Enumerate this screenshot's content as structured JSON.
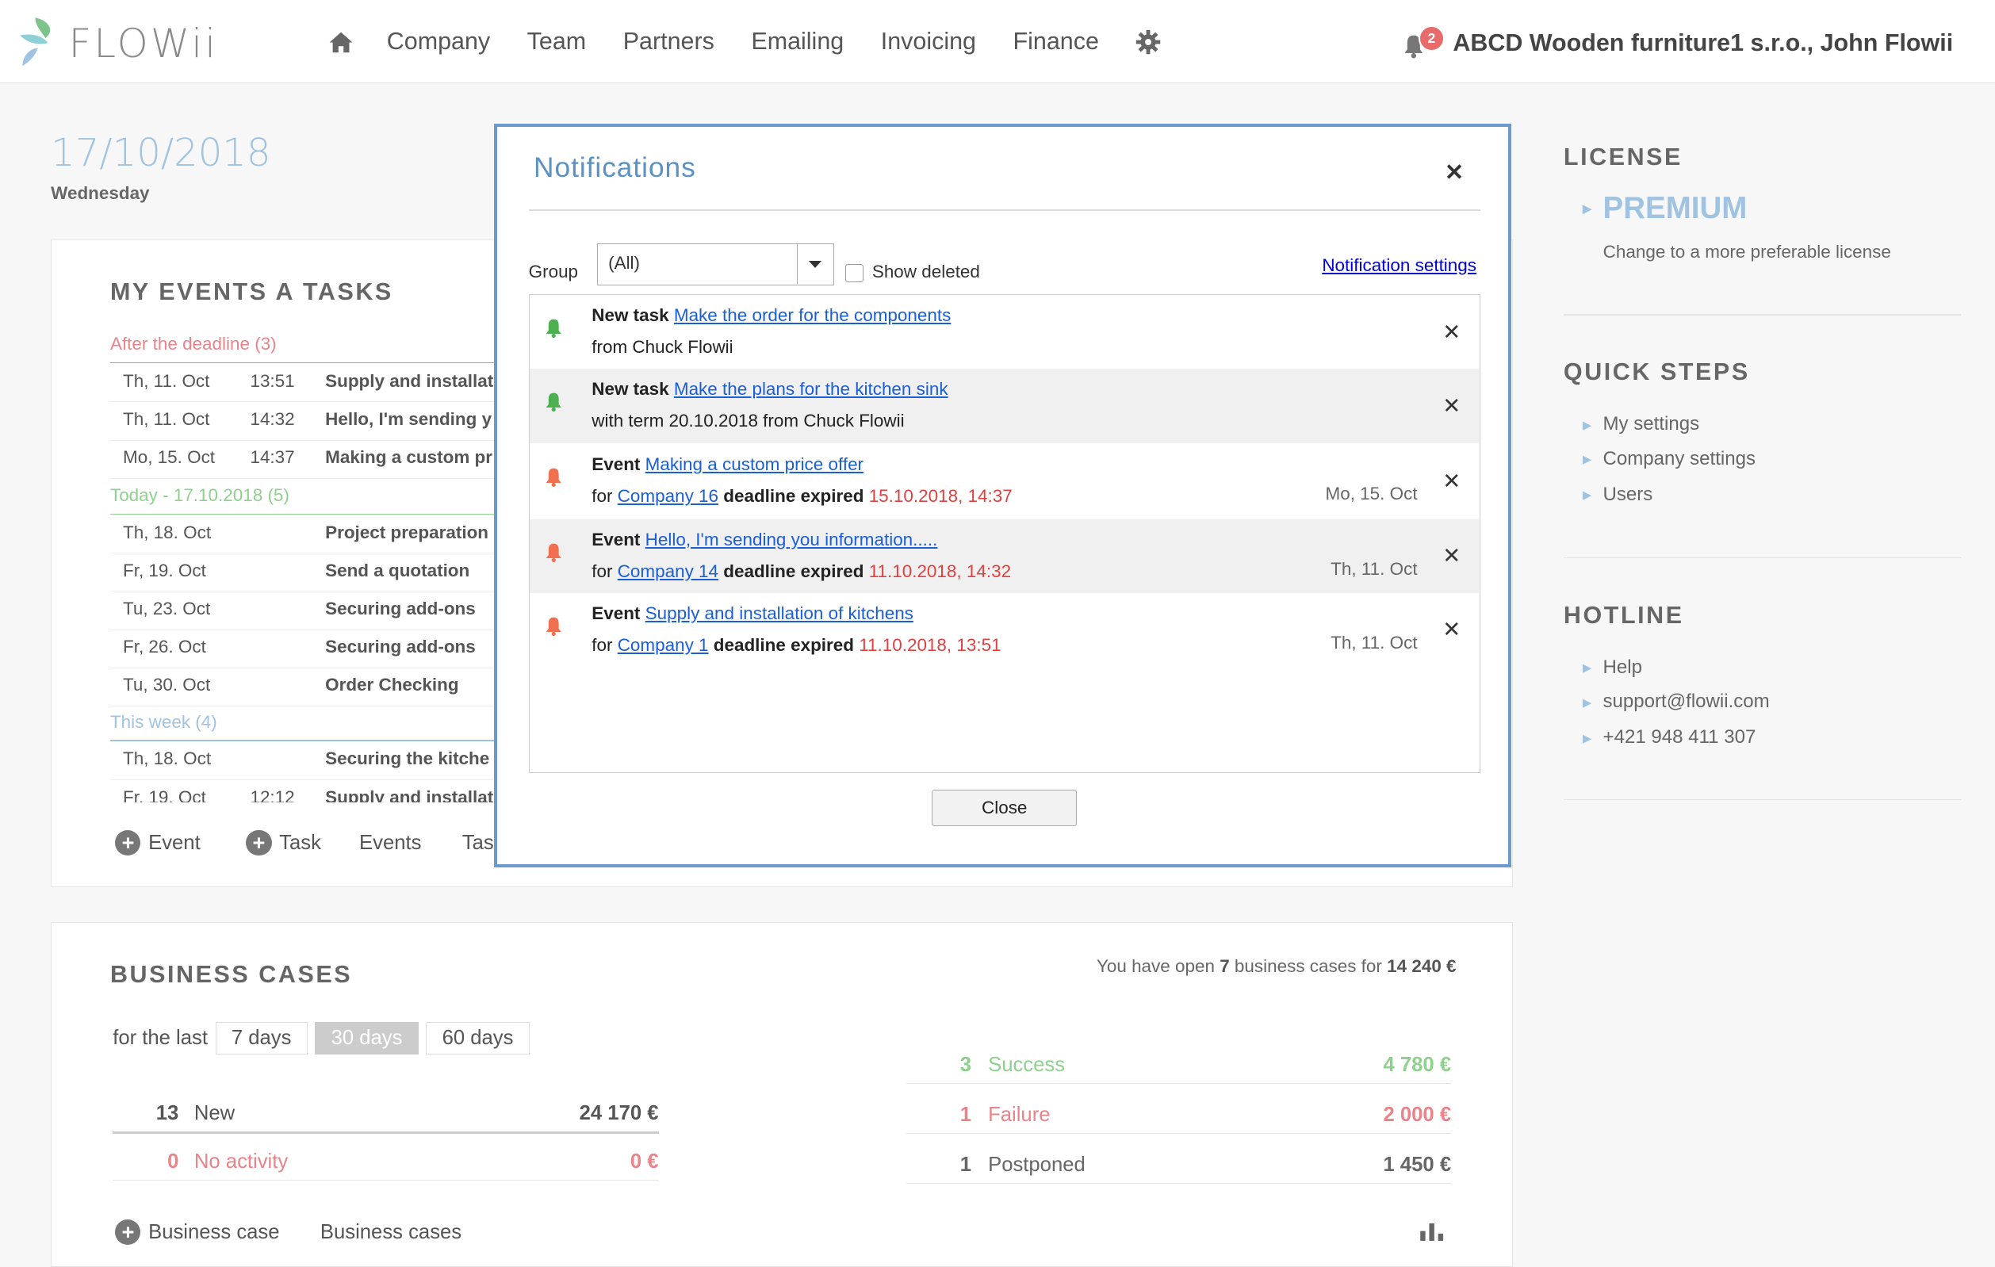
{
  "brand": {
    "logo_text": "FLOWii"
  },
  "nav": {
    "items": [
      "Company",
      "Team",
      "Partners",
      "Emailing",
      "Invoicing",
      "Finance"
    ],
    "notification_count": "2",
    "company_user": "ABCD Wooden furniture1 s.r.o., John Flowii"
  },
  "date": {
    "value": "17/10/2018",
    "weekday": "Wednesday"
  },
  "events": {
    "title": "MY EVENTS A TASKS",
    "groups": {
      "overdue": "After the deadline (3)",
      "today": "Today - 17.10.2018 (5)",
      "week": "This week (4)"
    },
    "overdue_rows": [
      {
        "date": "Th, 11. Oct",
        "time": "13:51",
        "name": "Supply and installat"
      },
      {
        "date": "Th, 11. Oct",
        "time": "14:32",
        "name": "Hello, I'm sending y"
      },
      {
        "date": "Mo, 15. Oct",
        "time": "14:37",
        "name": "Making a custom pr"
      }
    ],
    "today_rows": [
      {
        "date": "Th, 18. Oct",
        "time": "",
        "name": "Project preparation"
      },
      {
        "date": "Fr, 19. Oct",
        "time": "",
        "name": "Send a quotation"
      },
      {
        "date": "Tu, 23. Oct",
        "time": "",
        "name": "Securing add-ons"
      },
      {
        "date": "Fr, 26. Oct",
        "time": "",
        "name": "Securing add-ons"
      },
      {
        "date": "Tu, 30. Oct",
        "time": "",
        "name": "Order Checking"
      }
    ],
    "week_rows": [
      {
        "date": "Th, 18. Oct",
        "time": "",
        "name": "Securing the kitche"
      },
      {
        "date": "Fr, 19. Oct",
        "time": "12:12",
        "name": "Supply and installat"
      }
    ],
    "actions": {
      "add_event": "Event",
      "add_task": "Task",
      "events_link": "Events",
      "tasks_link": "Tas"
    }
  },
  "business_cases": {
    "title": "BUSINESS CASES",
    "summary_prefix": "You have open ",
    "summary_count": "7",
    "summary_mid": " business cases for ",
    "summary_amount": "14 240 €",
    "period_label": "for the last",
    "periods": [
      "7 days",
      "30 days",
      "60 days"
    ],
    "active_period": "30 days",
    "left_stats": [
      {
        "count": "13",
        "label": "New",
        "amount": "24 170 €",
        "color": "#555555"
      },
      {
        "count": "0",
        "label": "No activity",
        "amount": "0 €",
        "color": "#e8848a"
      }
    ],
    "right_stats": [
      {
        "count": "3",
        "label": "Success",
        "amount": "4 780 €",
        "color": "#8fd08f"
      },
      {
        "count": "1",
        "label": "Failure",
        "amount": "2 000 €",
        "color": "#e8848a"
      },
      {
        "count": "1",
        "label": "Postponed",
        "amount": "1 450 €",
        "color": "#666666"
      }
    ],
    "actions": {
      "add_case": "Business case",
      "cases_link": "Business cases"
    }
  },
  "sidebar": {
    "license_title": "LICENSE",
    "license_name": "PREMIUM",
    "license_sub": "Change to a more preferable license",
    "quick_title": "QUICK STEPS",
    "quick_items": [
      "My settings",
      "Company settings",
      "Users"
    ],
    "hotline_title": "HOTLINE",
    "hotline_items": [
      "Help",
      "support@flowii.com",
      "+421 948 411 307"
    ]
  },
  "modal": {
    "title": "Notifications",
    "group_label": "Group",
    "group_value": "(All)",
    "show_deleted": "Show deleted",
    "settings_link": "Notification settings",
    "close_button": "Close",
    "notifications": [
      {
        "kind": "New task",
        "link": "Make the order for the components",
        "l2a": "from Chuck Flowii",
        "company": "",
        "l2b": "",
        "deadline": "",
        "date": "",
        "bell": "#4caf50"
      },
      {
        "kind": "New task",
        "link": "Make the plans for the kitchen sink",
        "l2a": "with term 20.10.2018 from Chuck Flowii",
        "company": "",
        "l2b": "",
        "deadline": "",
        "date": "",
        "bell": "#4caf50"
      },
      {
        "kind": "Event",
        "link": "Making a custom price offer",
        "l2a": "for ",
        "company": "Company 16",
        "l2b": " deadline expired ",
        "deadline": "15.10.2018, 14:37",
        "date": "Mo, 15. Oct",
        "bell": "#f07050"
      },
      {
        "kind": "Event",
        "link": "Hello, I'm sending you information.....",
        "l2a": "for ",
        "company": "Company 14",
        "l2b": " deadline expired ",
        "deadline": "11.10.2018, 14:32",
        "date": "Th, 11. Oct",
        "bell": "#f07050"
      },
      {
        "kind": "Event",
        "link": "Supply and installation of kitchens",
        "l2a": "for ",
        "company": "Company 1",
        "l2b": " deadline expired ",
        "deadline": "11.10.2018, 13:51",
        "date": "Th, 11. Oct",
        "bell": "#f07050"
      }
    ]
  }
}
